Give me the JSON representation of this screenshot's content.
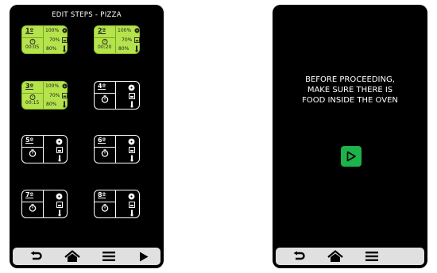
{
  "left_screen": {
    "title": "EDIT STEPS - PIZZA",
    "steps": [
      {
        "num": "1º",
        "fan": "100%",
        "humidity": "70%",
        "temp": "80%",
        "time": "00:05",
        "state": "active"
      },
      {
        "num": "2º",
        "fan": "100%",
        "humidity": "70%",
        "temp": "80%",
        "time": "00:20",
        "state": "active"
      },
      {
        "num": "3º",
        "fan": "100%",
        "humidity": "70%",
        "temp": "80%",
        "time": "00:15",
        "state": "active"
      },
      {
        "num": "4º",
        "state": "inactive"
      },
      {
        "num": "5º",
        "state": "inactive"
      },
      {
        "num": "6º",
        "state": "inactive"
      },
      {
        "num": "7º",
        "state": "inactive"
      },
      {
        "num": "8º",
        "state": "inactive"
      }
    ],
    "toolbar": [
      "back-icon",
      "home-icon",
      "menu-icon",
      "play-icon"
    ]
  },
  "right_screen": {
    "message_lines": [
      "BEFORE PROCEEDING,",
      "MAKE SURE THERE IS",
      "FOOD INSIDE THE OVEN"
    ],
    "toolbar": [
      "back-icon",
      "home-icon",
      "menu-icon"
    ]
  },
  "colors": {
    "active_step": "#b5e34b",
    "start_button": "#1db24a",
    "screen_bg": "#000000",
    "toolbar_bg": "#e0e0e0"
  }
}
